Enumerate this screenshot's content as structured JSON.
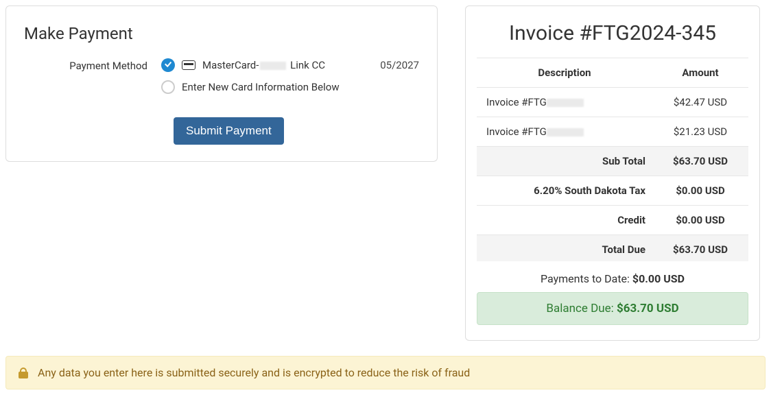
{
  "payment": {
    "heading": "Make Payment",
    "method_label": "Payment Method",
    "option1_prefix": "MasterCard-",
    "option1_suffix": " Link CC",
    "option1_expiry": "05/2027",
    "option2_label": "Enter New Card Information Below",
    "submit_label": "Submit Payment"
  },
  "invoice": {
    "title": "Invoice #FTG2024-345",
    "col_desc": "Description",
    "col_amount": "Amount",
    "items": [
      {
        "desc_prefix": "Invoice #FTG",
        "amount": "$42.47 USD"
      },
      {
        "desc_prefix": "Invoice #FTG",
        "amount": "$21.23 USD"
      }
    ],
    "subtotal_label": "Sub Total",
    "subtotal_value": "$63.70 USD",
    "tax_label": "6.20% South Dakota Tax",
    "tax_value": "$0.00 USD",
    "credit_label": "Credit",
    "credit_value": "$0.00 USD",
    "totaldue_label": "Total Due",
    "totaldue_value": "$63.70 USD",
    "paid_label": "Payments to Date: ",
    "paid_value": "$0.00 USD",
    "balance_label": "Balance Due: ",
    "balance_value": "$63.70 USD"
  },
  "secure_message": "Any data you enter here is submitted securely and is encrypted to reduce the risk of fraud"
}
